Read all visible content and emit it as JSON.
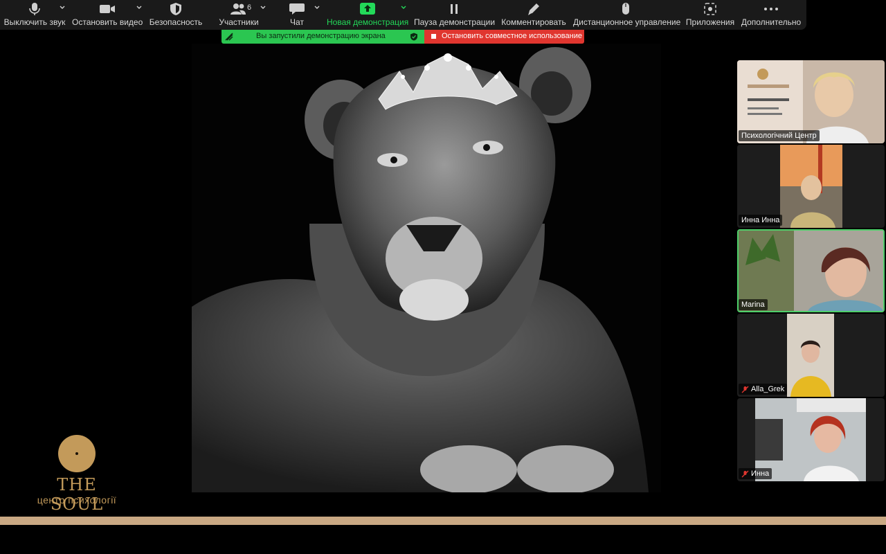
{
  "toolbar": {
    "items": [
      {
        "label": "Выключить звук",
        "icon": "microphone-icon"
      },
      {
        "label": "Остановить видео",
        "icon": "video-camera-icon"
      },
      {
        "label": "Безопасность",
        "icon": "shield-icon"
      },
      {
        "label": "Участники",
        "icon": "participants-icon",
        "count": "6"
      },
      {
        "label": "Чат",
        "icon": "chat-bubble-icon"
      },
      {
        "label": "Новая демонстрация",
        "icon": "share-screen-icon"
      },
      {
        "label": "Пауза демонстрации",
        "icon": "pause-icon"
      },
      {
        "label": "Комментировать",
        "icon": "pencil-icon"
      },
      {
        "label": "Дистанционное управление",
        "icon": "mouse-icon"
      },
      {
        "label": "Приложения",
        "icon": "apps-icon"
      },
      {
        "label": "Дополнительно",
        "icon": "more-dots-icon"
      }
    ]
  },
  "share_banner": {
    "status": "Вы запустили демонстрацию экрана",
    "stop": "Остановить совместное использование"
  },
  "logo": {
    "title": "THE SOUL",
    "subtitle": "центр психології"
  },
  "participants": [
    {
      "name": "Психологічний Центр",
      "muted": false,
      "active": false
    },
    {
      "name": "Инна Инна",
      "muted": false,
      "active": false
    },
    {
      "name": "Marina",
      "muted": false,
      "active": true
    },
    {
      "name": "Alla_Grek",
      "muted": true,
      "active": false
    },
    {
      "name": "Инна",
      "muted": true,
      "active": false
    }
  ],
  "colors": {
    "share_green": "#2bc651",
    "stop_red": "#e0362f",
    "brand_gold": "#c39a5a",
    "active_speaker": "#4ecf6a"
  }
}
